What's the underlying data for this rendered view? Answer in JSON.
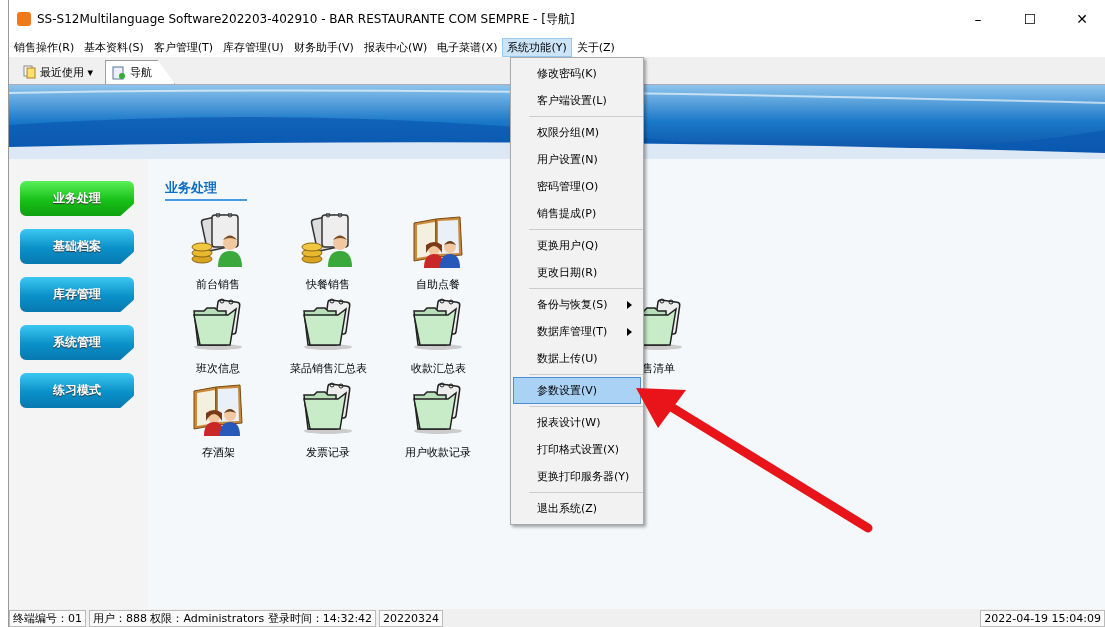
{
  "window": {
    "title": "SS-S12Multilanguage Software202203-402910 - BAR RESTAURANTE COM SEMPRE - [导航]",
    "controls": [
      "–",
      "☐",
      "✕"
    ]
  },
  "menu_bar": [
    {
      "label": "销售操作(R)",
      "selected": false
    },
    {
      "label": "基本资料(S)",
      "selected": false
    },
    {
      "label": "客户管理(T)",
      "selected": false
    },
    {
      "label": "库存管理(U)",
      "selected": false
    },
    {
      "label": "财务助手(V)",
      "selected": false
    },
    {
      "label": "报表中心(W)",
      "selected": false
    },
    {
      "label": "电子菜谱(X)",
      "selected": false
    },
    {
      "label": "系统功能(Y)",
      "selected": true
    },
    {
      "label": "关于(Z)",
      "selected": false
    }
  ],
  "toolbar": {
    "recent": "最近使用",
    "recent_caret": "▾",
    "tabs": [
      {
        "label": "导航",
        "selected": true
      }
    ]
  },
  "sidebar": [
    {
      "label": "业务处理",
      "selected": true
    },
    {
      "label": "基础档案",
      "selected": false
    },
    {
      "label": "库存管理",
      "selected": false
    },
    {
      "label": "系统管理",
      "selected": false
    },
    {
      "label": "练习模式",
      "selected": false
    }
  ],
  "section_title": "业务处理",
  "icon_rows": [
    [
      {
        "label": "前台销售",
        "kind": "cashier"
      },
      {
        "label": "快餐销售",
        "kind": "cashier"
      },
      {
        "label": "自助点餐",
        "kind": "book"
      }
    ],
    [
      {
        "label": "班次信息",
        "kind": "folder"
      },
      {
        "label": "菜品销售汇总表",
        "kind": "folder"
      },
      {
        "label": "收款汇总表",
        "kind": "folder"
      },
      {
        "label": "售清单",
        "kind": "folder",
        "skip_before": true
      }
    ],
    [
      {
        "label": "存酒架",
        "kind": "book"
      },
      {
        "label": "发票记录",
        "kind": "folder"
      },
      {
        "label": "用户收款记录",
        "kind": "folder"
      }
    ]
  ],
  "dropdown": [
    [
      {
        "label": "修改密码(K)",
        "selected": false,
        "submenu": false
      },
      {
        "label": "客户端设置(L)",
        "selected": false,
        "submenu": false
      }
    ],
    [
      {
        "label": "权限分组(M)",
        "selected": false,
        "submenu": false
      },
      {
        "label": "用户设置(N)",
        "selected": false,
        "submenu": false
      },
      {
        "label": "密码管理(O)",
        "selected": false,
        "submenu": false
      },
      {
        "label": "销售提成(P)",
        "selected": false,
        "submenu": false
      }
    ],
    [
      {
        "label": "更换用户(Q)",
        "selected": false,
        "submenu": false
      },
      {
        "label": "更改日期(R)",
        "selected": false,
        "submenu": false
      }
    ],
    [
      {
        "label": "备份与恢复(S)",
        "selected": false,
        "submenu": true
      },
      {
        "label": "数据库管理(T)",
        "selected": false,
        "submenu": true
      },
      {
        "label": "数据上传(U)",
        "selected": false,
        "submenu": false
      }
    ],
    [
      {
        "label": "参数设置(V)",
        "selected": true,
        "submenu": false
      }
    ],
    [
      {
        "label": "报表设计(W)",
        "selected": false,
        "submenu": false
      },
      {
        "label": "打印格式设置(X)",
        "selected": false,
        "submenu": false
      },
      {
        "label": "更换打印服务器(Y)",
        "selected": false,
        "submenu": false
      }
    ],
    [
      {
        "label": "退出系统(Z)",
        "selected": false,
        "submenu": false
      }
    ]
  ],
  "status_bar": [
    "终端编号：01",
    "用户：888 权限：Administrators 登录时间：14:32:42",
    "20220324",
    "2022-04-19 15:04:09"
  ]
}
